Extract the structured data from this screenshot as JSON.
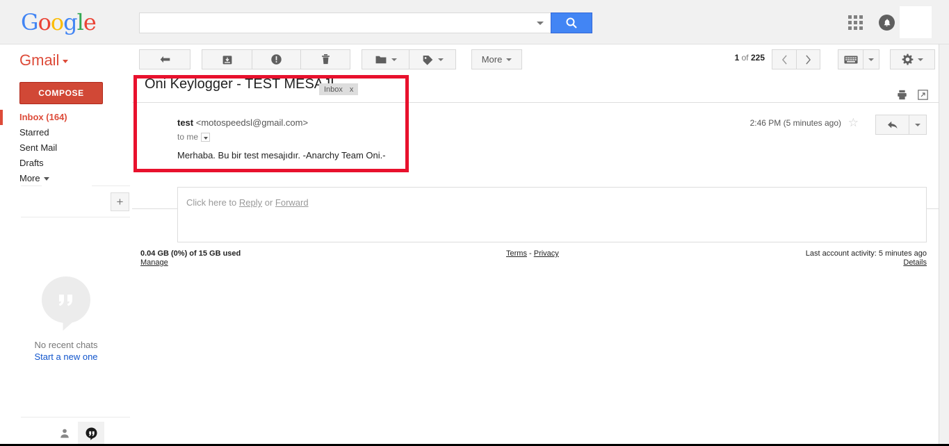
{
  "topbar": {
    "logo": {
      "parts": [
        "G",
        "o",
        "o",
        "g",
        "l",
        "e"
      ]
    },
    "search": {
      "value": "",
      "placeholder": "",
      "dropdown_icon": "chevron-down-icon",
      "button_icon": "search-icon"
    },
    "apps_icon": "apps-grid-icon",
    "notifications_icon": "bell-icon",
    "avatar_label": ""
  },
  "brand": {
    "name": "Gmail"
  },
  "toolbar": {
    "back_icon": "back-arrow-icon",
    "archive_icon": "archive-icon",
    "spam_icon": "report-spam-icon",
    "delete_icon": "trash-icon",
    "move_icon": "folder-icon",
    "labels_icon": "label-tag-icon",
    "more_label": "More",
    "keyboard_icon": "keyboard-icon",
    "settings_icon": "gear-icon"
  },
  "pager": {
    "current": "1",
    "of": " of ",
    "total": "225",
    "prev_icon": "chevron-left-icon",
    "next_icon": "chevron-right-icon"
  },
  "sidebar": {
    "compose_label": "COMPOSE",
    "items": [
      {
        "label": "Inbox (164)",
        "active": true
      },
      {
        "label": "Starred",
        "active": false
      },
      {
        "label": "Sent Mail",
        "active": false
      },
      {
        "label": "Drafts",
        "active": false
      }
    ],
    "more_label": "More",
    "add_label": "+",
    "chat": {
      "icon": "hangouts-bubble-icon",
      "empty_label": "No recent chats",
      "start_link": "Start a new one"
    },
    "bottom_icons": {
      "people": "contacts-person-icon",
      "hangouts": "hangouts-icon"
    }
  },
  "email": {
    "subject": "Oni Keylogger - TEST MESAJI",
    "label_chip": "Inbox",
    "label_chip_remove": "x",
    "print_icon": "print-icon",
    "popout_icon": "open-in-new-window-icon",
    "sender_name": "test",
    "sender_address": "<motospeedsl@gmail.com>",
    "recipient": "to me",
    "body": "Merhaba. Bu bir test mesajıdır. -Anarchy Team Oni.-",
    "timestamp": "2:46 PM (5 minutes ago)",
    "star_icon": "star-outline-icon",
    "reply_icon": "reply-arrow-icon",
    "reply_more_icon": "chevron-down-icon"
  },
  "reply_area": {
    "prefix": "Click here to ",
    "reply_label": "Reply",
    "middle": " or ",
    "forward_label": "Forward"
  },
  "footer": {
    "storage": "0.04 GB (0%) of 15 GB used",
    "manage": "Manage",
    "terms": "Terms",
    "separator": " - ",
    "privacy": "Privacy",
    "activity": "Last account activity: 5 minutes ago",
    "details": "Details"
  },
  "colors": {
    "google_blue": "#4285f4",
    "gmail_red": "#dd4b39",
    "compose_red": "#d14836",
    "annotation_red": "#e8112d",
    "link_blue": "#1155cc"
  }
}
